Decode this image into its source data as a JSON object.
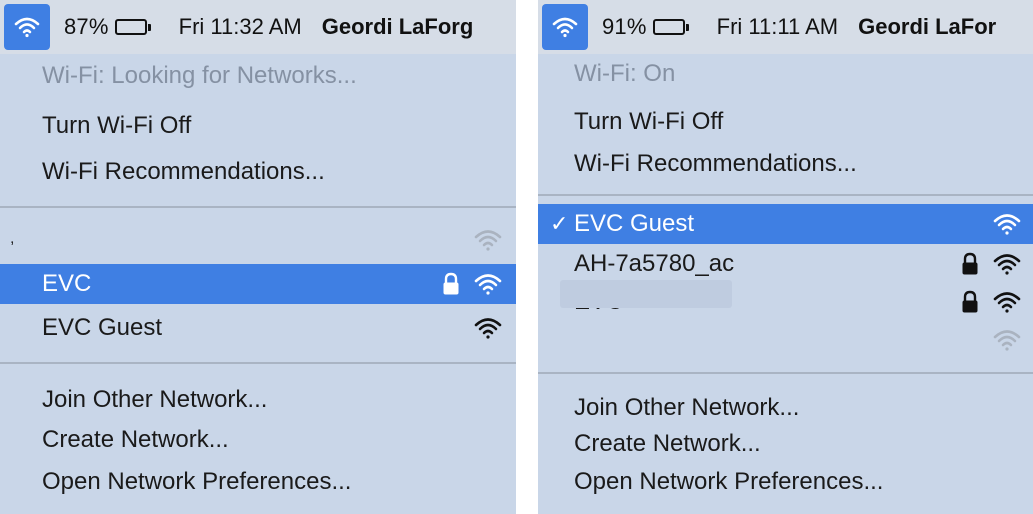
{
  "left": {
    "menubar": {
      "battery_pct": "87%",
      "battery_level": 0.87,
      "time": "Fri 11:32 AM",
      "user": "Geordi LaForg"
    },
    "status": "Wi-Fi: Looking for Networks...",
    "turn_wifi": "Turn Wi-Fi Off",
    "recommendations": "Wi-Fi Recommendations...",
    "networks": [
      {
        "name": "",
        "locked": false,
        "signal": "weak",
        "selected": false
      },
      {
        "name": "EVC",
        "locked": true,
        "signal": "full",
        "selected": true
      },
      {
        "name": "EVC Guest",
        "locked": false,
        "signal": "full",
        "selected": false
      }
    ],
    "join_other": "Join Other Network...",
    "create_network": "Create Network...",
    "open_prefs": "Open Network Preferences..."
  },
  "right": {
    "menubar": {
      "battery_pct": "91%",
      "battery_level": 0.91,
      "time": "Fri 11:11 AM",
      "user": "Geordi LaFor"
    },
    "status": "Wi-Fi: On",
    "turn_wifi": "Turn Wi-Fi Off",
    "recommendations": "Wi-Fi Recommendations...",
    "networks": [
      {
        "name": "EVC Guest",
        "locked": false,
        "signal": "full",
        "selected": true,
        "checked": true
      },
      {
        "name": "AH-7a5780_ac",
        "locked": true,
        "signal": "full",
        "selected": false
      },
      {
        "name": "EVC",
        "locked": true,
        "signal": "full",
        "selected": false
      },
      {
        "name": "",
        "locked": false,
        "signal": "weak",
        "selected": false
      }
    ],
    "checkmark": "✓",
    "join_other": "Join Other Network...",
    "create_network": "Create Network...",
    "open_prefs": "Open Network Preferences..."
  },
  "colors": {
    "accent": "#3f7fe3",
    "menu_bg": "#c9d6e8",
    "menubar_bg": "#d6dde7",
    "disabled_text": "#8591a3"
  },
  "icons": [
    "wifi-icon",
    "battery-icon",
    "lock-icon",
    "checkmark-icon"
  ]
}
